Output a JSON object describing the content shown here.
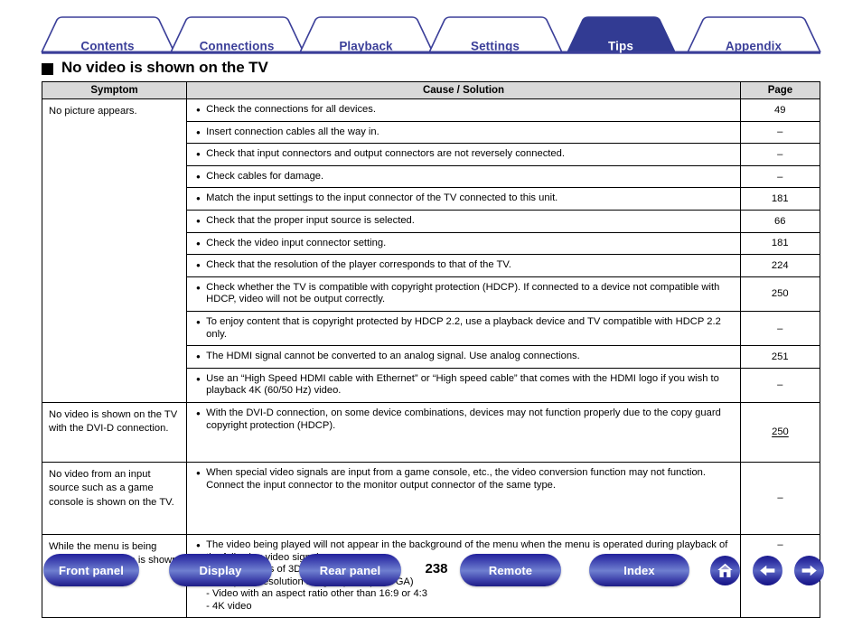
{
  "tabs": [
    {
      "label": "Contents",
      "active": false
    },
    {
      "label": "Connections",
      "active": false
    },
    {
      "label": "Playback",
      "active": false
    },
    {
      "label": "Settings",
      "active": false
    },
    {
      "label": "Tips",
      "active": true
    },
    {
      "label": "Appendix",
      "active": false
    }
  ],
  "heading": "No video is shown on the TV",
  "table": {
    "headers": [
      "Symptom",
      "Cause / Solution",
      "Page"
    ],
    "dash": "–",
    "rows": [
      {
        "symptom": "No picture appears.",
        "items": [
          {
            "text": "Check the connections for all devices.",
            "page": "49",
            "link": true
          },
          {
            "text": "Insert connection cables all the way in.",
            "page": "–",
            "link": false
          },
          {
            "text": "Check that input connectors and output connectors are not reversely connected.",
            "page": "–",
            "link": false
          },
          {
            "text": "Check cables for damage.",
            "page": "–",
            "link": false
          },
          {
            "text": "Match the input settings to the input connector of the TV connected to this unit.",
            "page": "181",
            "link": true
          },
          {
            "text": "Check that the proper input source is selected.",
            "page": "66",
            "link": true
          },
          {
            "text": "Check the video input connector setting.",
            "page": "181",
            "link": true
          },
          {
            "text": "Check that the resolution of the player corresponds to that of the TV.",
            "page": "224",
            "link": true
          },
          {
            "text": "Check whether the TV is compatible with copyright protection (HDCP). If connected to a device not compatible with HDCP, video will not be output correctly.",
            "page": "250",
            "link": true
          },
          {
            "text": "To enjoy content that is copyright protected by HDCP 2.2, use a playback device and TV compatible with HDCP 2.2 only.",
            "page": "–",
            "link": false
          },
          {
            "text": "The HDMI signal cannot be converted to an analog signal. Use analog connections.",
            "page": "251",
            "link": true
          },
          {
            "text": "Use an “High Speed HDMI cable with Ethernet” or “High speed cable” that comes with the HDMI logo if you wish to playback 4K (60/50 Hz) video.",
            "page": "–",
            "link": false
          }
        ]
      },
      {
        "symptom": "No video is shown on the TV with the DVI-D connection.",
        "items": [
          {
            "text": "With the DVI-D connection, on some device combinations, devices may not function properly due to the copy guard copyright protection (HDCP).",
            "page": "250",
            "link": true
          }
        ]
      },
      {
        "symptom": "No video from an input source such as a game console is shown on the TV.",
        "items": [
          {
            "text": "When special video signals are input from a game console, etc., the video conversion function may not function. Connect the input connector to the monitor output connector of the same type.",
            "page": "–",
            "link": false
          }
        ]
      },
      {
        "symptom": "While the menu is being displayed, no video is shown on the TV.",
        "items": [
          {
            "text": "The video being played will not appear in the background of the menu when the menu is operated during playback of the following video signals.",
            "sublines": [
              "- Some images of 3D video contents",
              "- Computer resolution images (example: VGA)",
              "- Video with an aspect ratio other than 16:9 or 4:3",
              "- 4K video"
            ],
            "page": "–",
            "link": false
          }
        ]
      }
    ]
  },
  "bottom": {
    "buttons": [
      {
        "label": "Front panel"
      },
      {
        "label": "Display"
      },
      {
        "label": "Rear panel"
      },
      {
        "label": "Remote"
      },
      {
        "label": "Index"
      }
    ],
    "page_number": "238",
    "icons": [
      "home-icon",
      "arrow-left-icon",
      "arrow-right-icon"
    ]
  },
  "colors": {
    "brand_blue": "#3b3f99",
    "tab_active_bg": "#323b93",
    "header_grey": "#d9d9d9"
  }
}
